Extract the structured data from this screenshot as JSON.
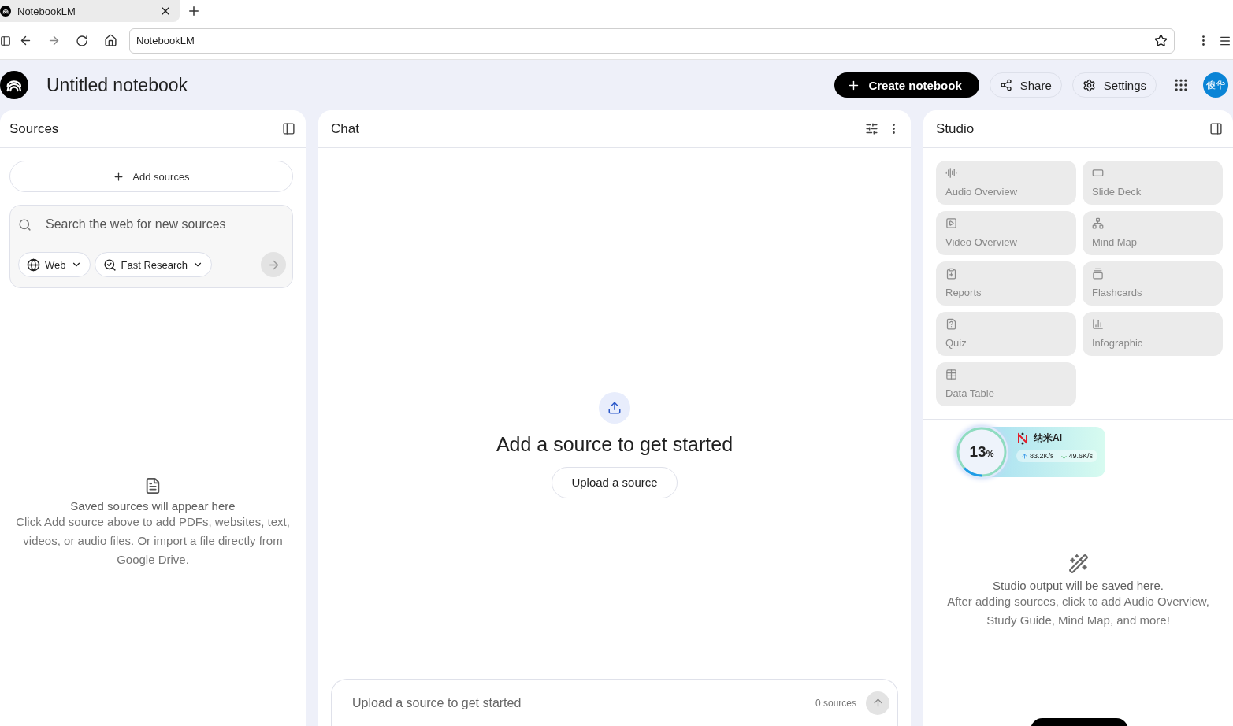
{
  "browser": {
    "tab_title": "NotebookLM",
    "address": "NotebookLM"
  },
  "header": {
    "title": "Untitled notebook",
    "create_button": "Create notebook",
    "share_button": "Share",
    "settings_button": "Settings",
    "avatar": "傻华"
  },
  "sources": {
    "title": "Sources",
    "add_button": "Add sources",
    "search": {
      "placeholder": "Search the web for new sources"
    },
    "chips": [
      {
        "label": "Web",
        "kind": "globe"
      },
      {
        "label": "Fast Research",
        "kind": "research"
      }
    ],
    "empty": {
      "title": "Saved sources will appear here",
      "text": "Click Add source above to add PDFs, websites, text, videos, or audio files. Or import a file directly from Google Drive."
    }
  },
  "chat": {
    "title": "Chat",
    "prompt": "Add a source to get started",
    "upload_button": "Upload a source",
    "composer": {
      "placeholder": "Upload a source to get started",
      "count": "0 sources"
    }
  },
  "studio": {
    "title": "Studio",
    "tiles": [
      {
        "label": "Audio Overview",
        "kind": "audio"
      },
      {
        "label": "Slide Deck",
        "kind": "slides"
      },
      {
        "label": "Video Overview",
        "kind": "video"
      },
      {
        "label": "Mind Map",
        "kind": "mindmap"
      },
      {
        "label": "Reports",
        "kind": "reports"
      },
      {
        "label": "Flashcards",
        "kind": "flashcards"
      },
      {
        "label": "Quiz",
        "kind": "quiz"
      },
      {
        "label": "Infographic",
        "kind": "infographic"
      },
      {
        "label": "Data Table",
        "kind": "table"
      }
    ],
    "empty": {
      "title": "Studio output will be saved here.",
      "text": "After adding sources, click to add Audio Overview, Study Guide, Mind Map, and more!"
    }
  },
  "widget": {
    "percent": "13",
    "unit": "%",
    "level": 0.13,
    "name": "纳米AI",
    "upload": "83.2K/s",
    "download": "49.6K/s"
  }
}
